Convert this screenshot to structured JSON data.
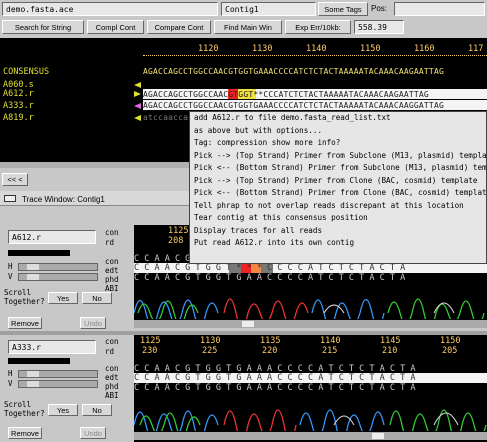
{
  "toolbar": {
    "filename": "demo.fasta.ace",
    "contig": "Contig1",
    "some_tags": "Some Tags",
    "pos_label": "Pos:",
    "search_label": "Search for String",
    "compl_cont": "Compl Cont",
    "compare_cont": "Compare Cont",
    "find_main_win": "Find Main Win",
    "exp_err": "Exp Err/10kb:",
    "exp_err_value": "558.39"
  },
  "ruler": [
    "1120",
    "1130",
    "1140",
    "1150",
    "1160",
    "117"
  ],
  "rows": [
    {
      "name": "CONSENSUS",
      "seq": "AGACCAGCCTGGCCAACGTGGTGAAACCCCATCTCTACTAAAAATACAAACAAGAATTAG"
    },
    {
      "name": "A060.s",
      "seq": ""
    },
    {
      "name": "A612.r",
      "seq": "AGACCAGCCTGGCCAACGTGGT**CCCATCTCTACTAAAAATACAAACAAGAATTAG"
    },
    {
      "name": "A333.r",
      "seq": "AGACCAGCCTGGCCAACGTGGTGAAACCCCATCTCTACTAAAAATACAAACAAGGATTAG"
    },
    {
      "name": "A819.r",
      "seq": "atccaaccac"
    }
  ],
  "nav_arrows": "<< <",
  "trace_window_title": "Trace Window: Contig1",
  "menu_items": [
    "add A612.r to file demo.fasta_read_list.txt",
    "   as above but with options...",
    "Tag: compression  show more info?",
    "Pick --> (Top Strand) Primer from Subclone (M13, plasmid) template",
    "Pick <-- (Bottom Strand) Primer from Subclone (M13, plasmid) template",
    "Pick --> (Top Strand) Primer from Clone (BAC, cosmid) template",
    "Pick <-- (Bottom Strand) Primer from Clone (BAC, cosmid) template",
    "Tell phrap to not overlap reads discrepant at this location",
    "Tear contig at this consensus position",
    "Display traces for all reads",
    "Put read A612.r into its own contig"
  ],
  "trace1": {
    "read": "A612.r",
    "pos_top": "1125",
    "pos_bottom": "208",
    "rows": [
      "con",
      "rd",
      "con",
      "edt",
      "phd",
      "ABI"
    ],
    "h_label": "H",
    "v_label": "V",
    "scroll_together": "Scroll\nTogether?",
    "yes": "Yes",
    "no": "No",
    "remove": "Remove",
    "undo": "Undo",
    "con_bases": "C C A A C G T G G T G A A A C C C C A T C T C T A C T A",
    "edt_bases": "C C A A C G T G G T * * * C C C C A T C T C T A C T A",
    "phd_bases": "C C A A C G T G G T G A A C C C C A T C T C T A C T A"
  },
  "trace2": {
    "read": "A333.r",
    "positions_top": [
      "1125",
      "1130",
      "1135",
      "1140",
      "1145",
      "1150"
    ],
    "positions_bottom": [
      "230",
      "225",
      "220",
      "215",
      "210",
      "205"
    ],
    "rows": [
      "con",
      "rd",
      "con",
      "edt",
      "phd",
      "ABI"
    ],
    "h_label": "H",
    "v_label": "V",
    "scroll_together": "Scroll\nTogether?",
    "yes": "Yes",
    "no": "No",
    "remove": "Remove",
    "undo": "Undo",
    "con_bases": "C C A A C G T G G T G A A A C C C C A T C T C T A C T A",
    "edt_bases": "C C A A C G T G G T G A A A C C C C A T C T C T A C T A",
    "phd_bases": "C C A A C G T G G T G A A A C C C C A T C T C T A C T A"
  },
  "colors": {
    "panel_bg": "#c8c8c8",
    "dark_bg": "#000000",
    "ruler": "#ffcc66",
    "read_name": "#e0e030",
    "highlight_red": "#ee2222",
    "highlight_yellow": "#f0e040"
  },
  "icons": [
    "window-icon",
    "arrow-right-icon",
    "slider-icon"
  ]
}
